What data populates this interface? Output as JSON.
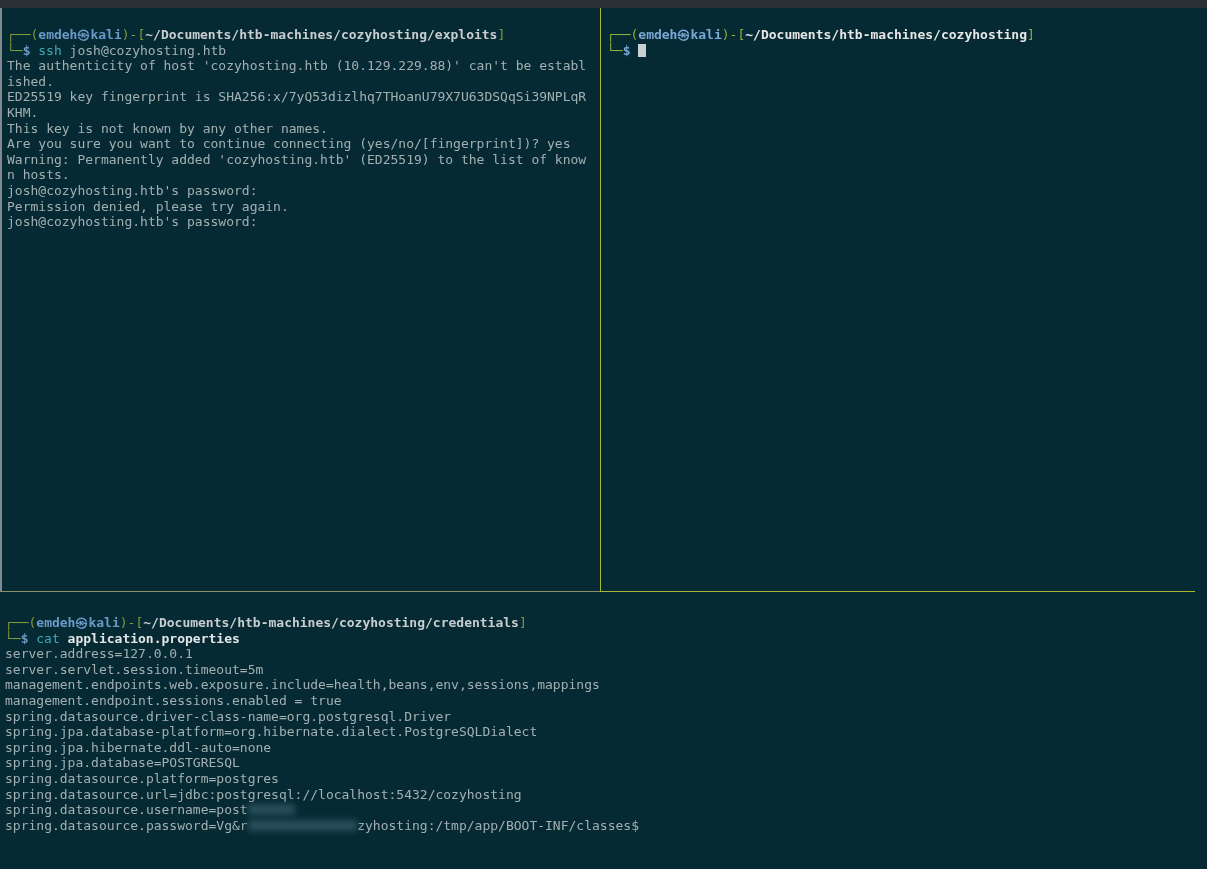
{
  "top_panes": [
    {
      "active": false,
      "prompt": [
        {
          "kind": "frame",
          "text": "┌──("
        },
        {
          "kind": "user",
          "text": "emdeh㉿kali"
        },
        {
          "kind": "frame",
          "text": ")-["
        },
        {
          "kind": "path",
          "text": "~/Documents/htb-machines/cozyhosting/exploits"
        },
        {
          "kind": "frame",
          "text": "]"
        }
      ],
      "command": [
        {
          "kind": "frame",
          "text": "└─"
        },
        {
          "kind": "symbol",
          "text": "$"
        },
        {
          "kind": "program",
          "text": "ssh"
        },
        {
          "kind": "arg",
          "text": "josh@cozyhosting.htb"
        }
      ],
      "output": [
        {
          "text": "The authenticity of host 'cozyhosting.htb (10.129.229.88)' can't be establ"
        },
        {
          "text": "ished."
        },
        {
          "text": "ED25519 key fingerprint is SHA256:x/7yQ53dizlhq7THoanU79X7U63DSQqSi39NPLqR"
        },
        {
          "text": "KHM."
        },
        {
          "text": "This key is not known by any other names."
        },
        {
          "text": "Are you sure you want to continue connecting (yes/no/[fingerprint])? yes"
        },
        {
          "text": "Warning: Permanently added 'cozyhosting.htb' (ED25519) to the list of know"
        },
        {
          "text": "n hosts."
        },
        {
          "text": "josh@cozyhosting.htb's password:"
        },
        {
          "text": "Permission denied, please try again."
        },
        {
          "text": "josh@cozyhosting.htb's password:"
        }
      ]
    },
    {
      "active": true,
      "cursor": true,
      "prompt": [
        {
          "kind": "frame",
          "text": "┌──("
        },
        {
          "kind": "user",
          "text": "emdeh㉿kali"
        },
        {
          "kind": "frame",
          "text": ")-["
        },
        {
          "kind": "path",
          "text": "~/Documents/htb-machines/cozyhosting"
        },
        {
          "kind": "frame",
          "text": "]"
        }
      ],
      "command": [
        {
          "kind": "frame",
          "text": "└─"
        },
        {
          "kind": "symbol",
          "text": "$"
        }
      ]
    }
  ],
  "bottom_pane": {
    "active": false,
    "prompt": [
      {
        "kind": "frame",
        "text": "┌──("
      },
      {
        "kind": "user",
        "text": "emdeh㉿kali"
      },
      {
        "kind": "frame",
        "text": ")-["
      },
      {
        "kind": "path",
        "text": "~/Documents/htb-machines/cozyhosting/credentials"
      },
      {
        "kind": "frame",
        "text": "]"
      }
    ],
    "command": [
      {
        "kind": "frame",
        "text": "└─"
      },
      {
        "kind": "symbol",
        "text": "$"
      },
      {
        "kind": "program",
        "text": "cat"
      },
      {
        "kind": "file",
        "text": "application.properties"
      }
    ],
    "output": [
      {
        "text": "server.address=127.0.0.1"
      },
      {
        "text": "server.servlet.session.timeout=5m"
      },
      {
        "text": "management.endpoints.web.exposure.include=health,beans,env,sessions,mappings"
      },
      {
        "text": "management.endpoint.sessions.enabled = true"
      },
      {
        "text": "spring.datasource.driver-class-name=org.postgresql.Driver"
      },
      {
        "text": "spring.jpa.database-platform=org.hibernate.dialect.PostgreSQLDialect"
      },
      {
        "text": "spring.jpa.hibernate.ddl-auto=none"
      },
      {
        "text": "spring.jpa.database=POSTGRESQL"
      },
      {
        "text": "spring.datasource.platform=postgres"
      },
      {
        "text": "spring.datasource.url=jdbc:postgresql://localhost:5432/cozyhosting"
      },
      {
        "text": "spring.datasource.username=post",
        "redacted": true
      },
      {
        "text": "spring.datasource.password=Vg&r",
        "redacted": true,
        "after": "zyhosting:/tmp/app/BOOT-INF/classes$"
      }
    ]
  }
}
